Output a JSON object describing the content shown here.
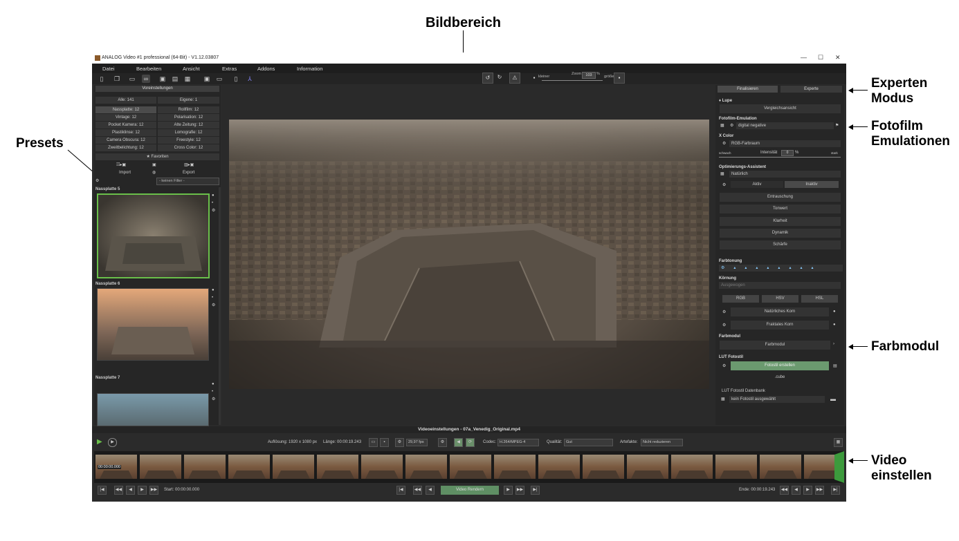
{
  "annotations": {
    "bildbereich": "Bildbereich",
    "experten_line1": "Experten",
    "experten_line2": "Modus",
    "presets": "Presets",
    "fotofilm_line1": "Fotofilm",
    "fotofilm_line2": "Emulationen",
    "farbmodul": "Farbmodul",
    "video_line1": "Video",
    "video_line2": "einstellen"
  },
  "window": {
    "title": "ANALOG Video #1 professional (64-Bit) - V1.12.03807",
    "minimize": "—",
    "maximize": "☐",
    "close": "✕"
  },
  "menu": [
    "Datei",
    "Bearbeiten",
    "Ansicht",
    "Extras",
    "Addons",
    "Information"
  ],
  "zoom": {
    "label": "Zoom",
    "value": "103",
    "unit": "%",
    "smaller": "kleiner",
    "larger": "größer"
  },
  "left": {
    "header": "Voreinstellungen",
    "all": "Alle: 141",
    "own": "Eigene: 1",
    "presets": [
      [
        "Nassplatte: 12",
        "Rollfilm: 12"
      ],
      [
        "Vintage: 12",
        "Polarisation: 12"
      ],
      [
        "Pocket Kamera: 12",
        "Alte Zeitung: 12"
      ],
      [
        "Plastiklinse: 12",
        "Lomografie: 12"
      ],
      [
        "Camera Obscura: 12",
        "Freestyle: 12"
      ],
      [
        "Zweitbelichtung: 12",
        "Cross Color: 12"
      ]
    ],
    "favorites": "★ Favoriten",
    "import": "Import",
    "export": "Export",
    "filter": "- keinen Filter -",
    "thumb1": "Nassplatte 5",
    "thumb2": "Nassplatte 6",
    "thumb3": "Nassplatte 7"
  },
  "right": {
    "tab_final": "Finalisieren",
    "tab_expert": "Experte",
    "lupe": "♦ Lupe",
    "compare": "Vergleichsansicht",
    "fotofilm_title": "Fotofilm-Emulation",
    "fotofilm_value": "digital negative",
    "xcolor_title": "X Color",
    "xcolor_value": "RGB-Farbraum",
    "weak": "schwach",
    "intensity": "Intensität",
    "intensity_value": "0",
    "intensity_unit": "%",
    "strong": "stark",
    "opt_title": "Optimierungs-Assistent",
    "opt_value": "Natürlich",
    "active": "Aktiv",
    "inactive": "Inaktiv",
    "opt_items": [
      "Entrauschung",
      "Tonwert",
      "Klarheit",
      "Dynamik",
      "Schärfe"
    ],
    "farbtonung": "Farbtonung",
    "kornung": "Körnung",
    "korn_value": "Ausgewogen",
    "rgb": "RGB",
    "hsv": "HSV",
    "hsl": "HSL",
    "natural_grain": "Natürliches Korn",
    "fractal_grain": "Fraktales Korn",
    "farbmodul_title": "Farbmodul",
    "farbmodul_btn": "Farbmodul",
    "lut_title": "LUT Fotostil",
    "lut_btn": "Fotostil erstellen",
    "cube": ".cube",
    "lut_db": "LUT Fotostil Datenbank",
    "lut_db_value": "kein Fotostil ausgewählt"
  },
  "video": {
    "title": "Videoeinstellungen - 07a_Venedig_Original.mp4",
    "resolution": "Auflösung: 1920 x 1080 px",
    "length": "Länge: 00:00:19.243",
    "fps": "29,97 fps",
    "codec_label": "Codec:",
    "codec": "H.264/MPEG-4",
    "quality_label": "Qualität:",
    "quality": "Gut",
    "artifacts_label": "Artefakte:",
    "artifacts": "Nicht reduzieren",
    "timestamp": "00:00:00.000",
    "start": "Start: 00:00:00.000",
    "render": "Video Rendern",
    "end": "Ende: 00:00:19.243"
  },
  "colors": {
    "accent_green": "#6ac04a",
    "render_green": "#5f8f64",
    "panel_bg": "#262626"
  }
}
